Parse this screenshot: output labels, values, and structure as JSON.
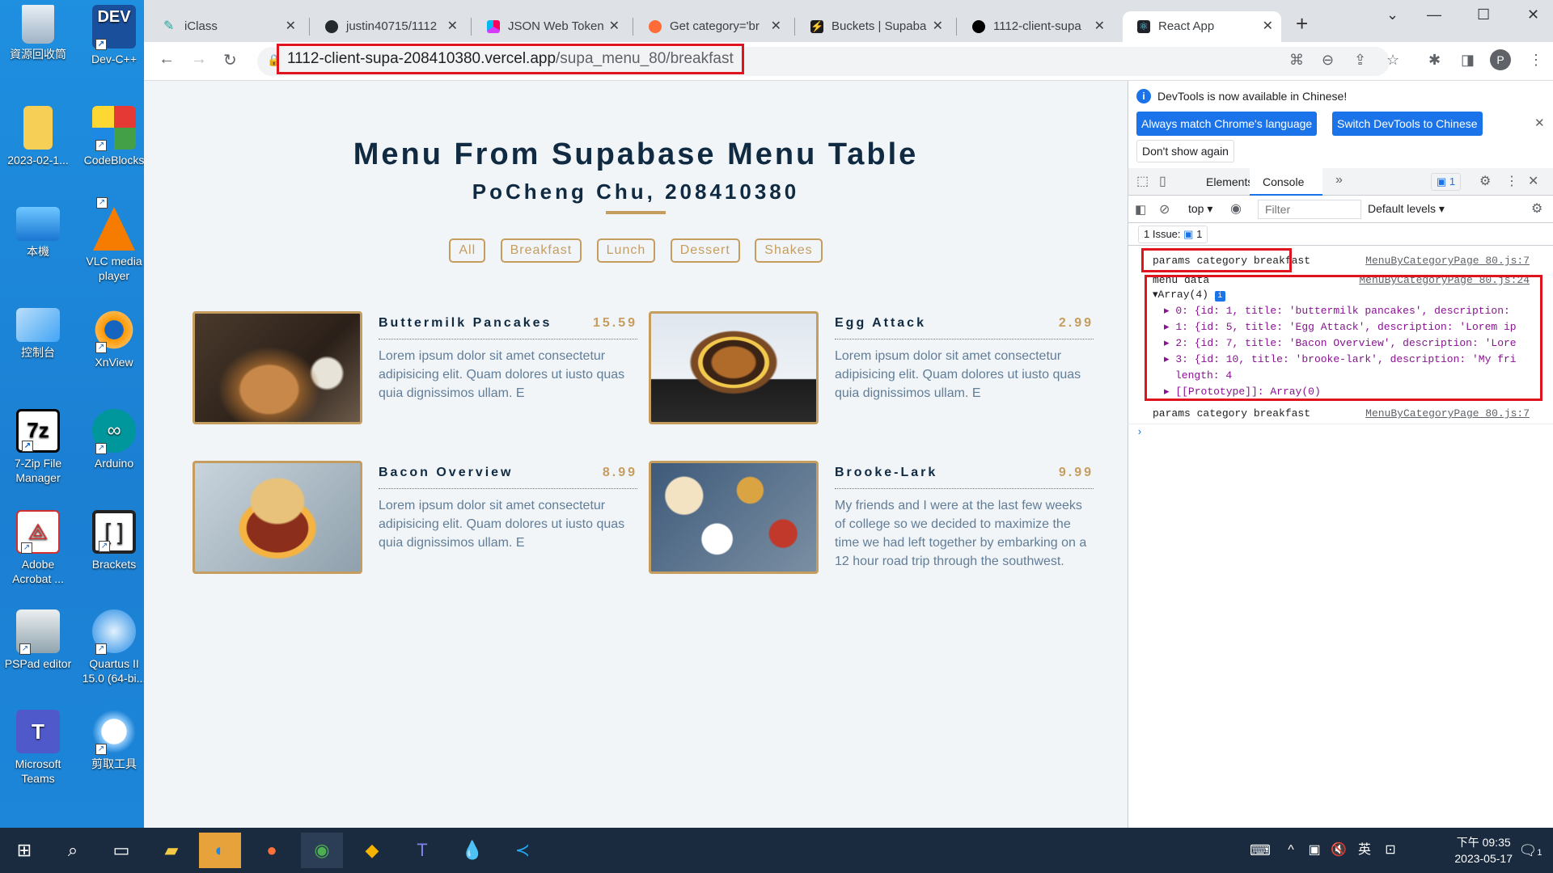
{
  "desktop": {
    "icons": [
      {
        "label": "資源回收筒",
        "icon": "recycle-bin-icon"
      },
      {
        "label": "Dev-C++",
        "icon": "devcpp-icon"
      },
      {
        "label": "2023-02-1...",
        "icon": "folder-icon"
      },
      {
        "label": "CodeBlocks",
        "icon": "codeblocks-icon"
      },
      {
        "label": "本機",
        "icon": "computer-icon"
      },
      {
        "label": "VLC media player",
        "icon": "vlc-icon"
      },
      {
        "label": "控制台",
        "icon": "control-panel-icon"
      },
      {
        "label": "XnView",
        "icon": "xnview-icon"
      },
      {
        "label": "7-Zip File Manager",
        "icon": "7zip-icon"
      },
      {
        "label": "Arduino",
        "icon": "arduino-icon"
      },
      {
        "label": "Adobe Acrobat ...",
        "icon": "acrobat-icon"
      },
      {
        "label": "Brackets",
        "icon": "brackets-icon"
      },
      {
        "label": "PSPad editor",
        "icon": "pspad-icon"
      },
      {
        "label": "Quartus II 15.0 (64-bi...",
        "icon": "quartus-icon"
      },
      {
        "label": "Microsoft Teams",
        "icon": "teams-icon"
      },
      {
        "label": "剪取工具",
        "icon": "snipping-tool-icon"
      }
    ]
  },
  "browser": {
    "tabs": [
      {
        "label": "iClass"
      },
      {
        "label": "justin40715/1112"
      },
      {
        "label": "JSON Web Token"
      },
      {
        "label": "Get category='br"
      },
      {
        "label": "Buckets | Supaba"
      },
      {
        "label": "1112-client-supa"
      },
      {
        "label": "React App"
      }
    ],
    "url_host": "1112-client-supa-208410380.vercel.app",
    "url_path": "/supa_menu_80/breakfast",
    "profile_initial": "P"
  },
  "page": {
    "title": "Menu From Supabase Menu Table",
    "subtitle": "PoCheng Chu, 208410380",
    "filters": [
      "All",
      "Breakfast",
      "Lunch",
      "Dessert",
      "Shakes"
    ],
    "items": [
      {
        "title": "Buttermilk Pancakes",
        "price": "15.59",
        "desc": "Lorem ipsum dolor sit amet consectetur adipisicing elit. Quam dolores ut iusto quas quia dignissimos ullam. E"
      },
      {
        "title": "Egg Attack",
        "price": "2.99",
        "desc": "Lorem ipsum dolor sit amet consectetur adipisicing elit. Quam dolores ut iusto quas quia dignissimos ullam. E"
      },
      {
        "title": "Bacon Overview",
        "price": "8.99",
        "desc": "Lorem ipsum dolor sit amet consectetur adipisicing elit. Quam dolores ut iusto quas quia dignissimos ullam. E"
      },
      {
        "title": "Brooke-Lark",
        "price": "9.99",
        "desc": "My friends and I were at the last few weeks of college so we decided to maximize the time we had left together by embarking on a 12 hour road trip through the southwest."
      }
    ]
  },
  "devtools": {
    "notice": "DevTools is now available in Chinese!",
    "btn_match": "Always match Chrome's language",
    "btn_switch": "Switch DevTools to Chinese",
    "btn_dont": "Don't show again",
    "tab_elements": "Elements",
    "tab_console": "Console",
    "issues_badge": "1",
    "context": "top",
    "filter_placeholder": "Filter",
    "levels": "Default levels",
    "issue_bar": "1 Issue:",
    "issue_count": "1",
    "log1": "params category breakfast",
    "log1_src": "MenuByCategoryPage_80.js:7",
    "log2": "menu data",
    "log2_src": "MenuByCategoryPage_80.js:24",
    "array_head": "Array(4)",
    "rows": [
      "0: {id: 1, title: 'buttermilk pancakes', description:",
      "1: {id: 5, title: 'Egg Attack', description: 'Lorem ip",
      "2: {id: 7, title: 'Bacon Overview', description: 'Lore",
      "3: {id: 10, title: 'brooke-lark', description: 'My fri"
    ],
    "length_row": "length: 4",
    "proto_row": "[[Prototype]]: Array(0)",
    "log3": "params category breakfast",
    "log3_src": "MenuByCategoryPage_80.js:7"
  },
  "taskbar": {
    "ime": "英",
    "time": "下午 09:35",
    "date": "2023-05-17",
    "notif_count": "1"
  }
}
